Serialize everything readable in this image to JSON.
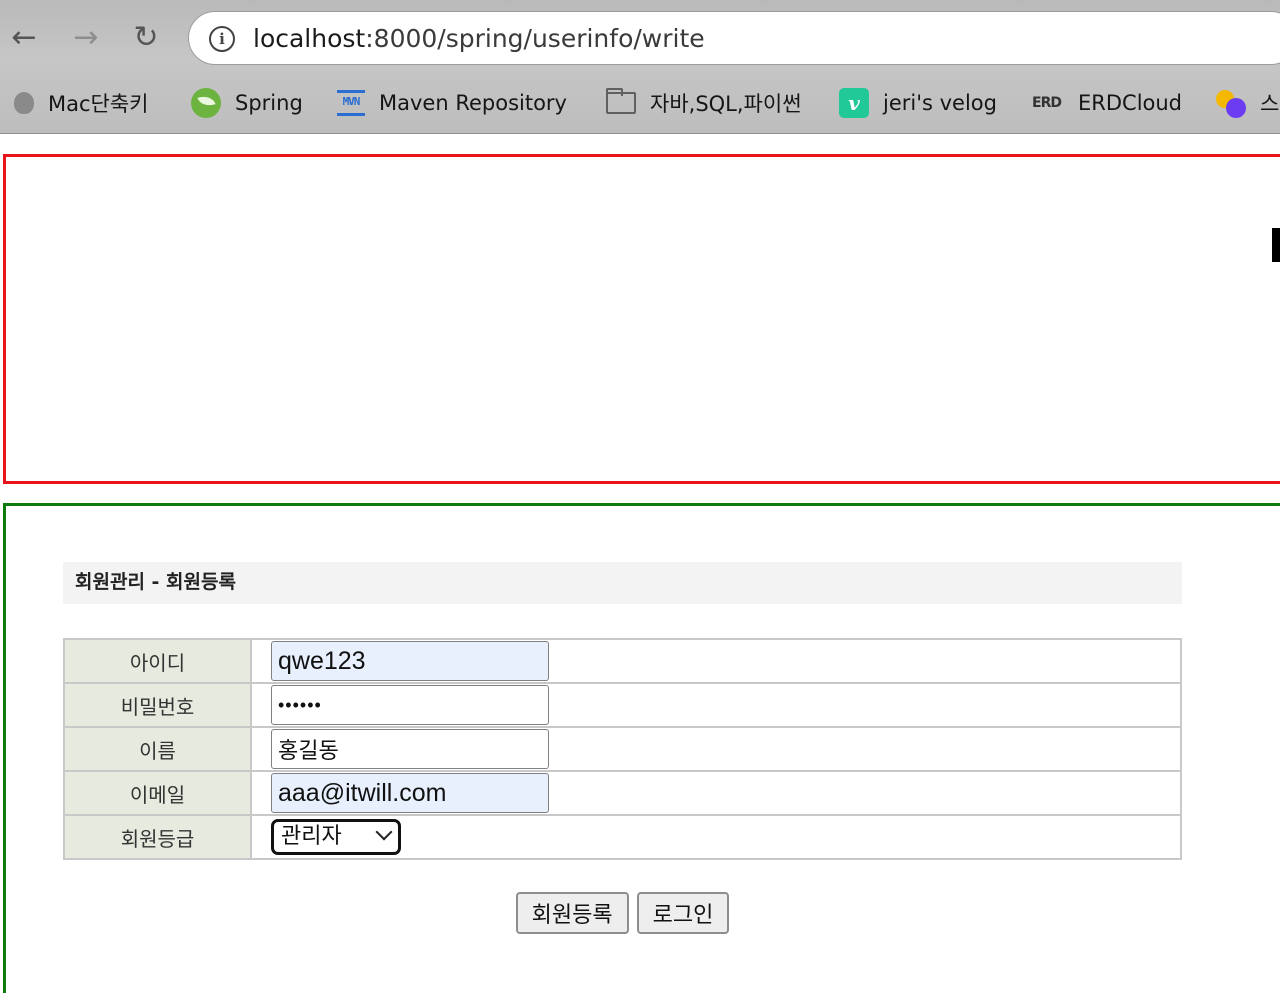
{
  "browser": {
    "url_host": "localhost",
    "url_rest": ":8000/spring/userinfo/write",
    "bookmarks": [
      {
        "label": "Mac단축키",
        "icon": "apple-icon"
      },
      {
        "label": "Spring",
        "icon": "spring-icon"
      },
      {
        "label": "Maven Repository",
        "icon": "maven-icon",
        "icon_text": "MVN"
      },
      {
        "label": "자바,SQL,파이썬",
        "icon": "folder-icon"
      },
      {
        "label": "jeri's velog",
        "icon": "velog-icon",
        "icon_text": "v"
      },
      {
        "label": "ERDCloud",
        "icon": "erd-icon",
        "icon_text": "ERD"
      },
      {
        "label": "스",
        "icon": "multicolor-icon"
      }
    ]
  },
  "page": {
    "title": "회원관리 - 회원등록",
    "form": {
      "id_label": "아이디",
      "id_value": "qwe123",
      "password_label": "비밀번호",
      "password_value": "••••••",
      "name_label": "이름",
      "name_value": "홍길동",
      "email_label": "이메일",
      "email_value": "aaa@itwill.com",
      "grade_label": "회원등급",
      "grade_value": "관리자"
    },
    "buttons": {
      "register": "회원등록",
      "login": "로그인"
    }
  },
  "colors": {
    "header_border": "#e8141b",
    "content_border": "#0f7a10",
    "label_bg": "#e6eadf",
    "autofill_bg": "#e8f0fe"
  }
}
